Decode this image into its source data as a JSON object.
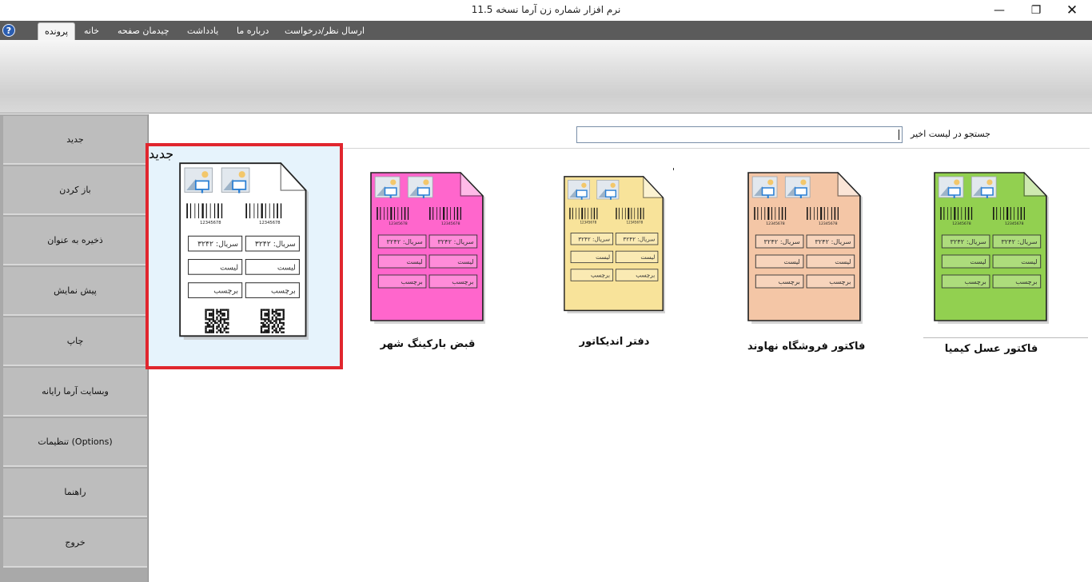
{
  "window": {
    "title": "نرم افزار شماره زن آرما نسخه 11.5",
    "minimize_glyph": "—",
    "maximize_glyph": "❐",
    "close_glyph": "✕"
  },
  "menu": {
    "help_glyph": "?",
    "items": [
      "پرونده",
      "خانه",
      "چیدمان صفحه",
      "یادداشت",
      "درباره ما",
      "ارسال نظر/درخواست"
    ]
  },
  "sidebar": {
    "items": [
      "جدید",
      "باز کردن",
      "ذخیره به عنوان",
      "پیش نمایش",
      "چاپ",
      "وبسایت آرما رایانه",
      "تنظیمات (Options)",
      "راهنما",
      "خروج"
    ]
  },
  "search": {
    "label": "جستجو در لیست اخیر",
    "value": ""
  },
  "templates": [
    {
      "label": "جدید",
      "color": "#ffffff",
      "selected": true
    },
    {
      "label": "قبض بارکینگ شهر",
      "color": "#ff66cc",
      "selected": false
    },
    {
      "label": "دفتر اندیکاتور",
      "color": "#f8e39a",
      "selected": false
    },
    {
      "label": "فاکتور فروشگاه نهاوند",
      "color": "#f4c6a6",
      "selected": false
    },
    {
      "label": "فاکتور عسل کیمیا",
      "color": "#92d050",
      "selected": false
    }
  ],
  "doc_text": {
    "barcode_number": "12345678",
    "serial": "سریال: ۳۲۴۲",
    "list": "لیست",
    "tag": "برچسب"
  },
  "colors": {
    "selection_border": "#e0262e",
    "menubar": "#5b5b5b",
    "sidebar": "#a9a9a9"
  }
}
